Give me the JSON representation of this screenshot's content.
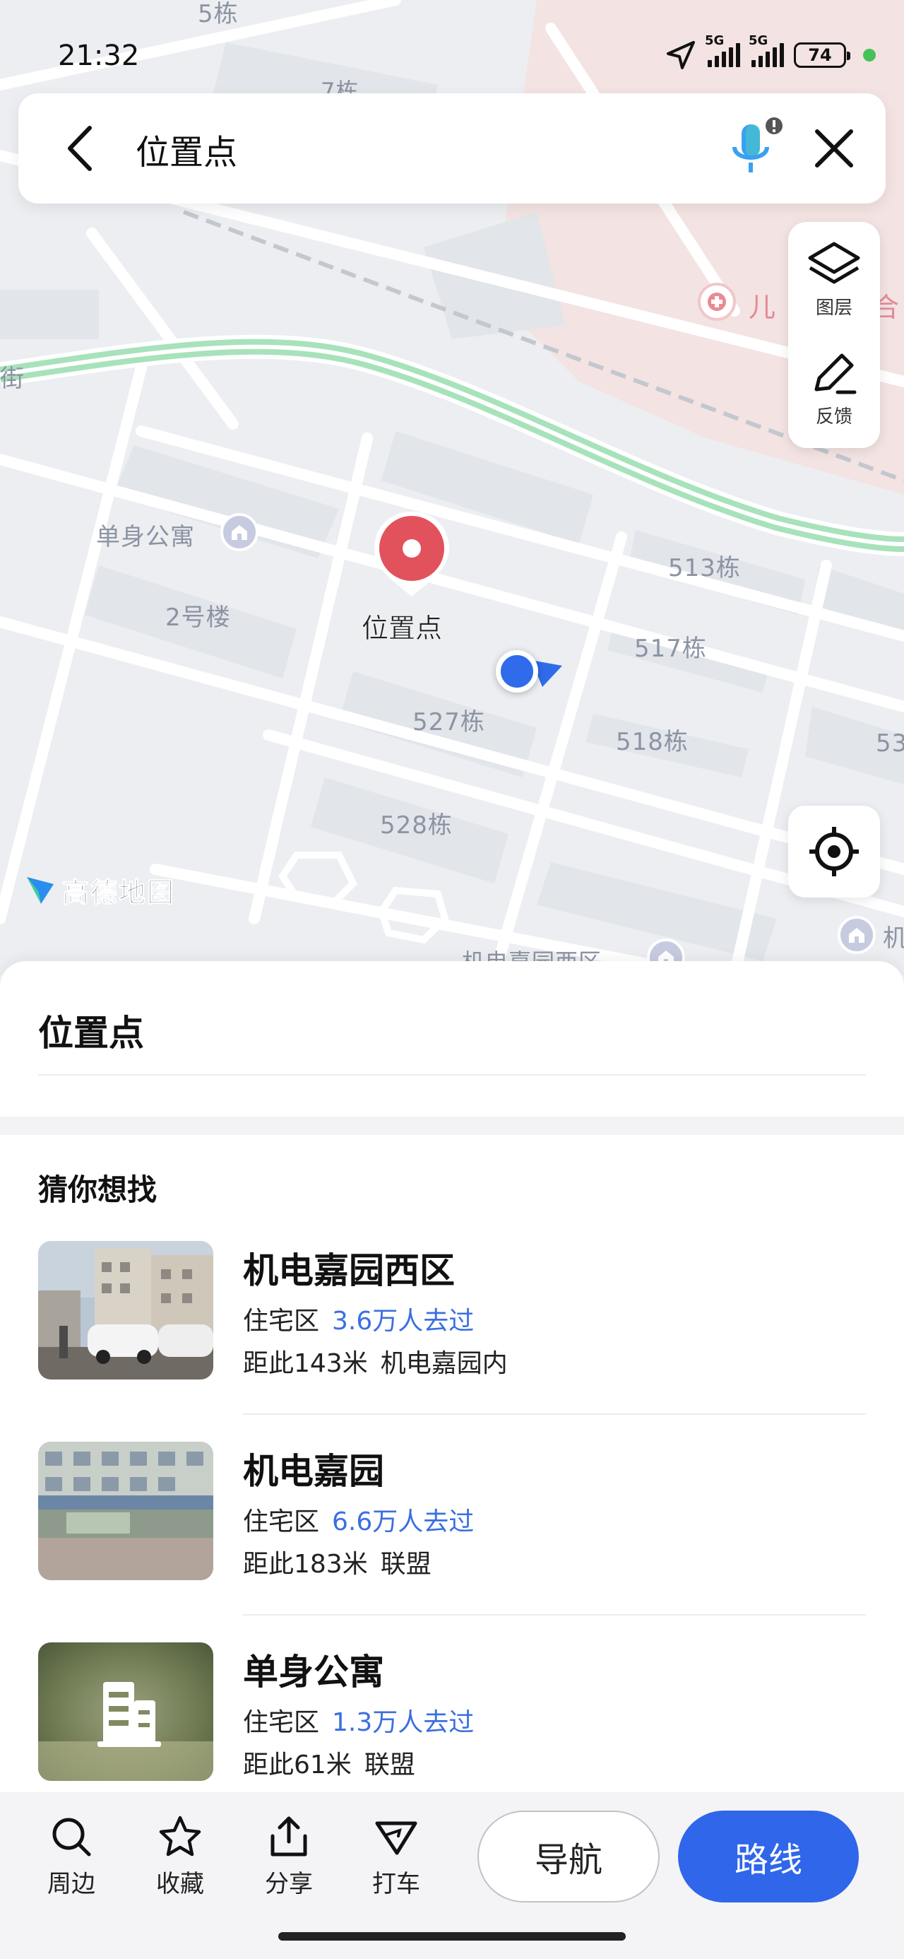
{
  "status_bar": {
    "time": "21:32",
    "network_1": "5G",
    "network_2": "5G",
    "battery": "74"
  },
  "search": {
    "query": "位置点"
  },
  "map_tools": {
    "layers_label": "图层",
    "feedback_label": "反馈"
  },
  "map": {
    "labels": {
      "street_fragment": "街",
      "danshen_gongyu": "单身公寓",
      "building_2": "2号楼",
      "b513": "513栋",
      "b517": "517栋",
      "b527": "527栋",
      "b518": "518栋",
      "b528": "528栋",
      "b53x": "53",
      "top_5": "5栋",
      "top_7": "7栋",
      "hospital": "儿",
      "hospital_tail": "综合",
      "jidian_west": "机电嘉园西区",
      "right_edge": "机"
    },
    "pin_label": "位置点",
    "logo_text": "高德地图"
  },
  "sheet": {
    "place_title": "位置点",
    "section_title": "猜你想找",
    "pois": [
      {
        "name": "机电嘉园西区",
        "category": "住宅区",
        "visits": "3.6万人去过",
        "distance": "距此143米",
        "extra": "机电嘉园内"
      },
      {
        "name": "机电嘉园",
        "category": "住宅区",
        "visits": "6.6万人去过",
        "distance": "距此183米",
        "extra": "联盟"
      },
      {
        "name": "单身公寓",
        "category": "住宅区",
        "visits": "1.3万人去过",
        "distance": "距此61米",
        "extra": "联盟"
      }
    ]
  },
  "bottom_bar": {
    "nearby": "周边",
    "favorite": "收藏",
    "share": "分享",
    "taxi": "打车",
    "navigate": "导航",
    "route": "路线"
  },
  "colors": {
    "accent": "#2f66ea",
    "link": "#3b6fe0",
    "pin": "#e2525c",
    "green_road": "#9fe0b4"
  }
}
